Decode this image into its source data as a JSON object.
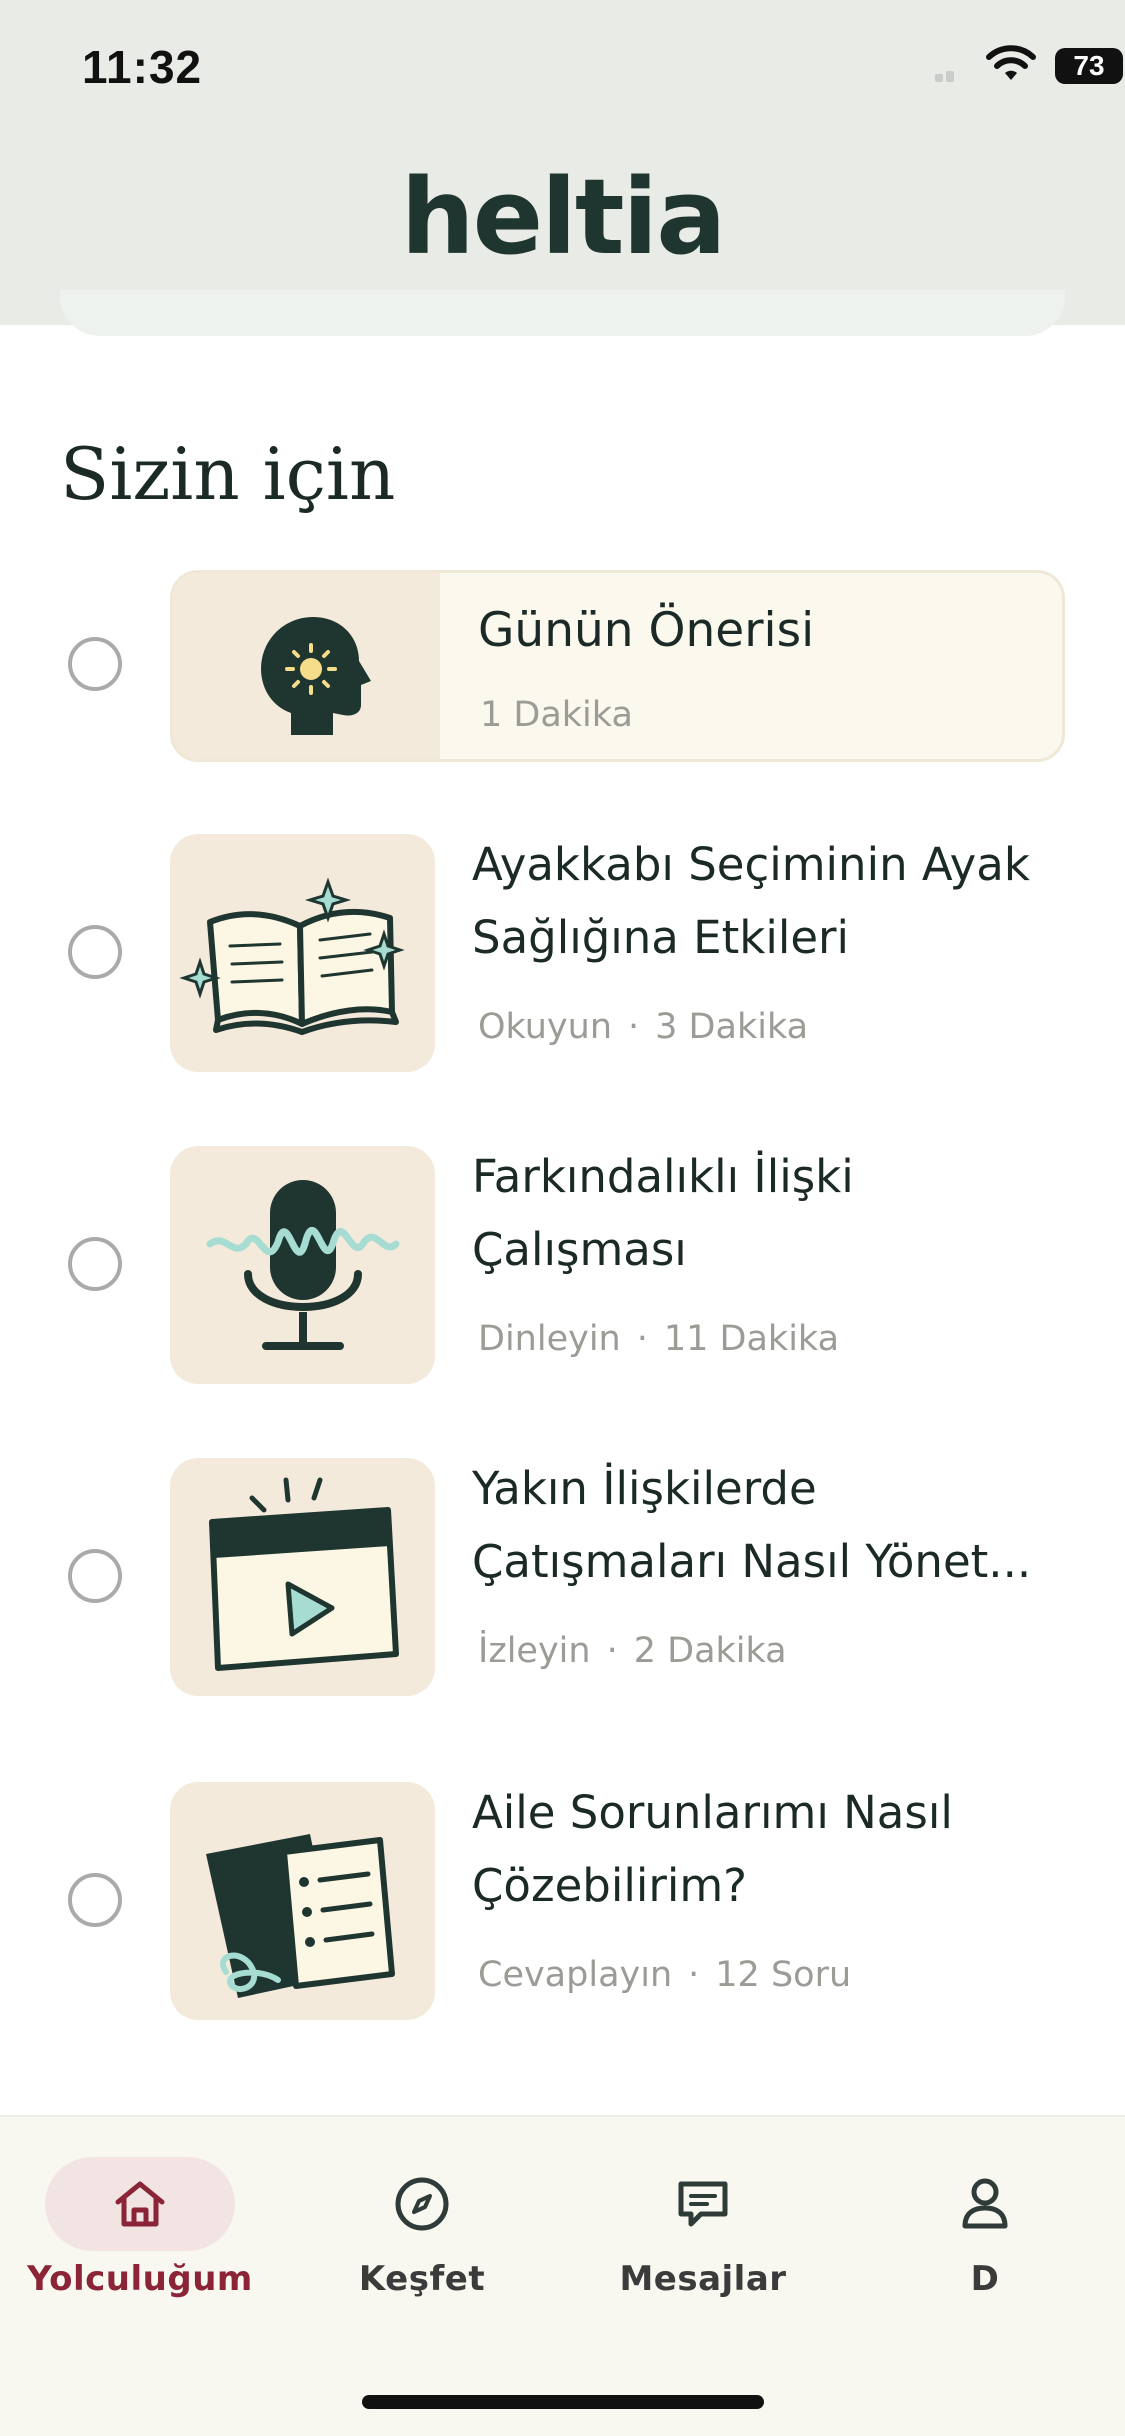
{
  "status_bar": {
    "time": "11:32",
    "battery": "73"
  },
  "header": {
    "logo": "heltia"
  },
  "section": {
    "title": "Sizin için"
  },
  "featured": {
    "title": "Günün Önerisi",
    "meta": "1 Dakika",
    "icon": "head-idea-icon"
  },
  "items": [
    {
      "title_line1": "Ayakkabı Seçiminin Ayak",
      "title_line2": "Sağlığına Etkileri",
      "type": "Okuyun",
      "dot": "·",
      "duration": "3 Dakika",
      "icon": "open-book-icon"
    },
    {
      "title_line1": "Farkındalıklı İlişki",
      "title_line2": "Çalışması",
      "type": "Dinleyin",
      "dot": "·",
      "duration": "11 Dakika",
      "icon": "microphone-icon"
    },
    {
      "title_line1": "Yakın İlişkilerde",
      "title_line2": "Çatışmaları Nasıl Yönet...",
      "type": "İzleyin",
      "dot": "·",
      "duration": "2 Dakika",
      "icon": "video-player-icon"
    },
    {
      "title_line1": "Aile Sorunlarımı Nasıl",
      "title_line2": "Çözebilirim?",
      "type": "Cevaplayın",
      "dot": "·",
      "duration": "12 Soru",
      "icon": "questionnaire-icon"
    }
  ],
  "nav": [
    {
      "label": "Yolculuğum",
      "icon": "home-icon",
      "active": true
    },
    {
      "label": "Keşfet",
      "icon": "compass-icon",
      "active": false
    },
    {
      "label": "Mesajlar",
      "icon": "message-icon",
      "active": false
    },
    {
      "label": "D",
      "icon": "profile-icon",
      "active": false
    }
  ],
  "colors": {
    "header_bg": "#e8ebe6",
    "accent": "#8a2436",
    "dark_green": "#1f3630",
    "thumb_bg": "#f4eadc",
    "muted_text": "#9c9b96"
  }
}
